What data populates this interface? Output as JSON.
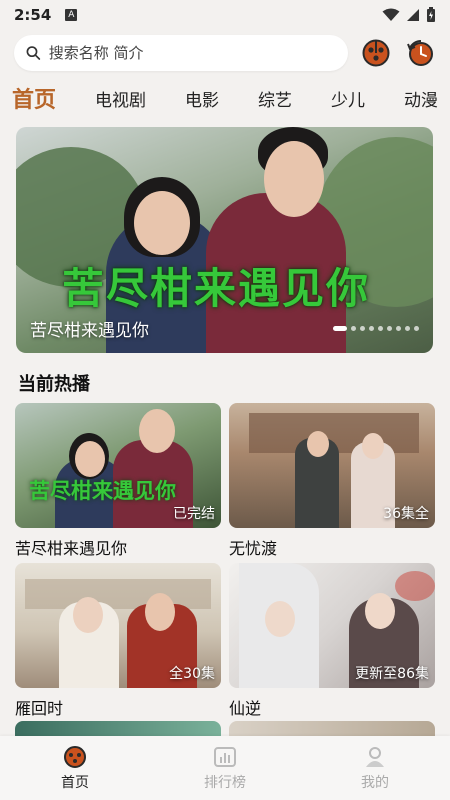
{
  "status": {
    "time": "2:54",
    "notif_letter": "A"
  },
  "search": {
    "placeholder": "搜索名称 简介"
  },
  "tabs": [
    {
      "label": "首页",
      "active": true
    },
    {
      "label": "电视剧"
    },
    {
      "label": "电影"
    },
    {
      "label": "综艺"
    },
    {
      "label": "少儿"
    },
    {
      "label": "动漫"
    }
  ],
  "banner": {
    "caption": "苦尽柑来遇见你",
    "art_title": "苦尽柑来遇见你",
    "slide_count": 9,
    "active_index": 0
  },
  "section": {
    "title": "当前热播"
  },
  "cards": [
    {
      "title": "苦尽柑来遇见你",
      "badge": "已完结",
      "art_title": "苦尽柑来遇见你"
    },
    {
      "title": "无忧渡",
      "badge": "36集全"
    },
    {
      "title": "雁回时",
      "badge": "全30集"
    },
    {
      "title": "仙逆",
      "badge": "更新至86集"
    }
  ],
  "nav": [
    {
      "label": "首页",
      "icon": "film-reel-icon",
      "active": true
    },
    {
      "label": "排行榜",
      "icon": "bar-chart-icon"
    },
    {
      "label": "我的",
      "icon": "user-icon"
    }
  ],
  "colors": {
    "accent": "#b8662a",
    "icon_brand": "#c9521e"
  }
}
